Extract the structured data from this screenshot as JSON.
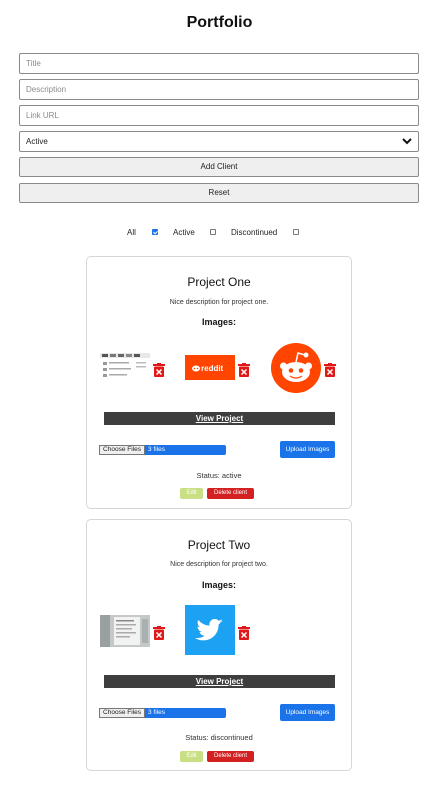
{
  "header": {
    "title": "Portfolio"
  },
  "form": {
    "title_placeholder": "Title",
    "description_placeholder": "Description",
    "link_placeholder": "Link URL",
    "status_selected": "Active",
    "add_label": "Add Client",
    "reset_label": "Reset"
  },
  "filters": {
    "all": {
      "label": "All",
      "checked": true
    },
    "active": {
      "label": "Active",
      "checked": false
    },
    "discontinued": {
      "label": "Discontinued",
      "checked": false
    }
  },
  "projects": [
    {
      "title": "Project One",
      "description": "Nice description for project one.",
      "images_label": "Images:",
      "images": [
        "screenshot-thumbnail",
        "reddit-logo-banner",
        "reddit-alien-logo"
      ],
      "view_label": "View Project",
      "file_button": "Choose Files",
      "file_count": "3 files",
      "upload_label": "Upload Images",
      "status": "Status: active",
      "edit_label": "Edit",
      "delete_label": "Delete client"
    },
    {
      "title": "Project Two",
      "description": "Nice description for project two.",
      "images_label": "Images:",
      "images": [
        "screenshot-thumbnail",
        "twitter-logo"
      ],
      "view_label": "View Project",
      "file_button": "Choose Files",
      "file_count": "3 files",
      "upload_label": "Upload Images",
      "status": "Status: discontinued",
      "edit_label": "Edit",
      "delete_label": "Delete client"
    }
  ],
  "colors": {
    "primary": "#1a73e8",
    "dark_bar": "#3e3e3e",
    "edit": "#c9df84",
    "delete": "#d32121",
    "reddit": "#ff4500",
    "twitter": "#1da1f2"
  }
}
